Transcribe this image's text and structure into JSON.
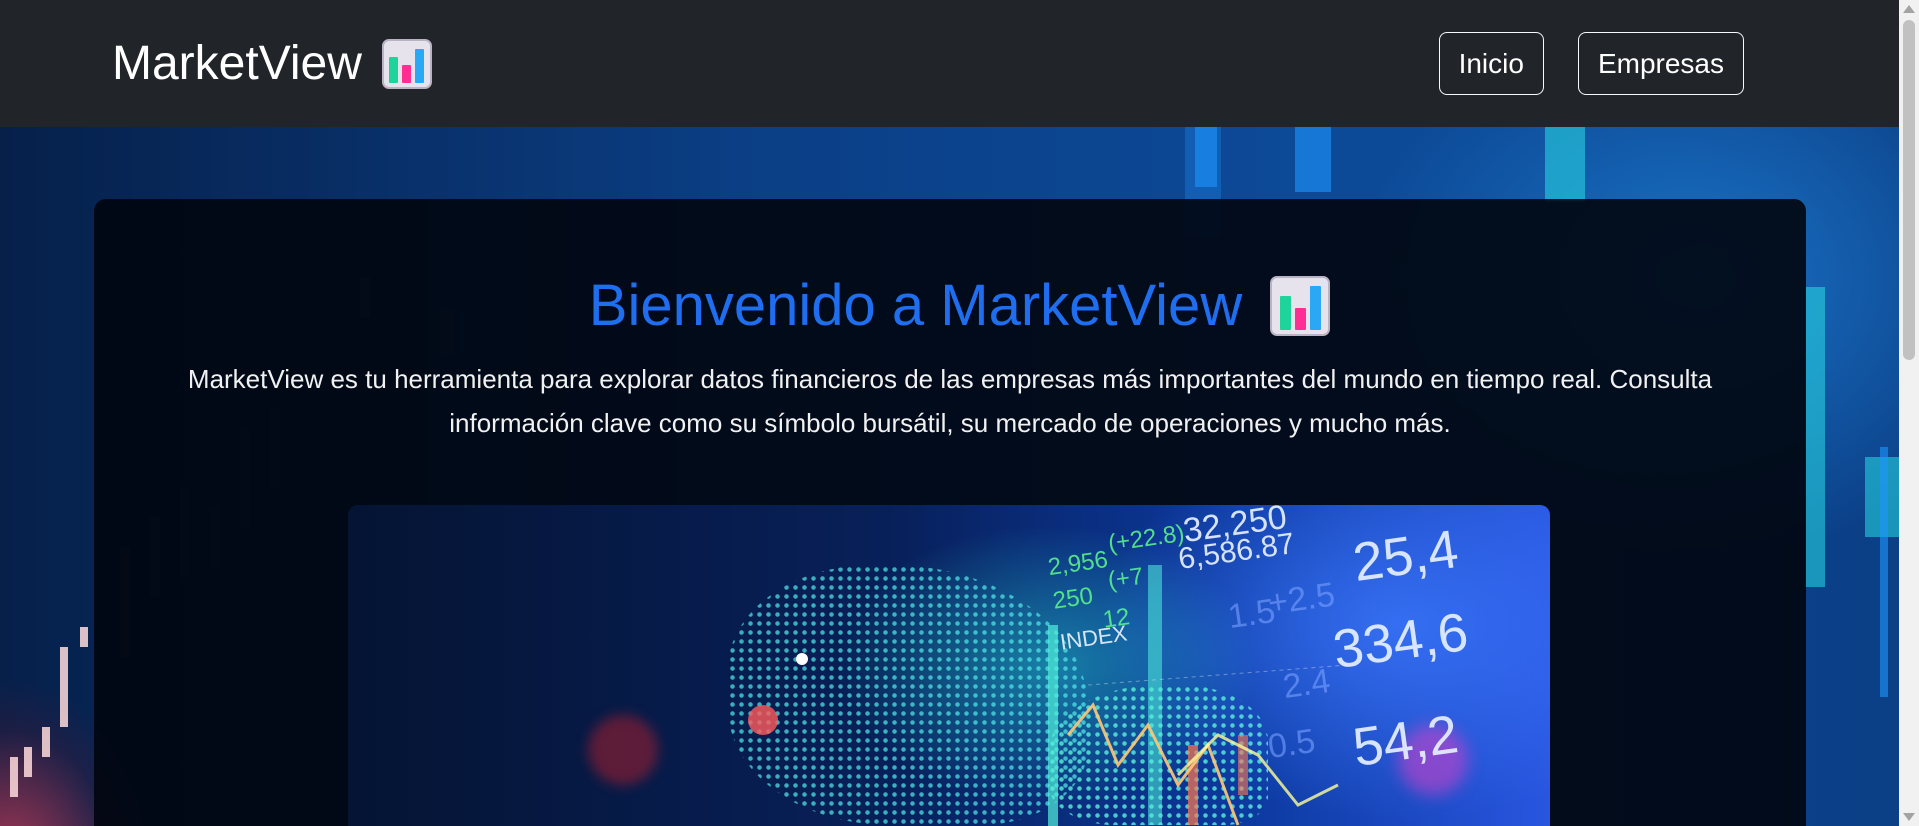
{
  "navbar": {
    "brand": "MarketView",
    "brand_icon": "bar-chart-emoji-icon",
    "links": [
      {
        "label": "Inicio"
      },
      {
        "label": "Empresas"
      }
    ]
  },
  "hero": {
    "title": "Bienvenido a MarketView",
    "title_icon": "bar-chart-emoji-icon",
    "description": "MarketView es tu herramienta para explorar datos financieros de las empresas más importantes del mundo en tiempo real. Consulta información clave como su símbolo bursátil, su mercado de operaciones y mucho más.",
    "image": {
      "numbers": [
        "32,250",
        "6,586.87",
        "25,4",
        "334,6",
        "54,2",
        "2,956",
        "(+22.8)",
        "250",
        "(+7",
        "12",
        "INDEX",
        "1.5",
        "+2.5",
        "2.4",
        "0.5"
      ]
    }
  },
  "colors": {
    "navbar_bg": "#212529",
    "title_color": "#1f6ef0",
    "card_bg": "#01060e",
    "text_color": "#f1f1f1"
  }
}
